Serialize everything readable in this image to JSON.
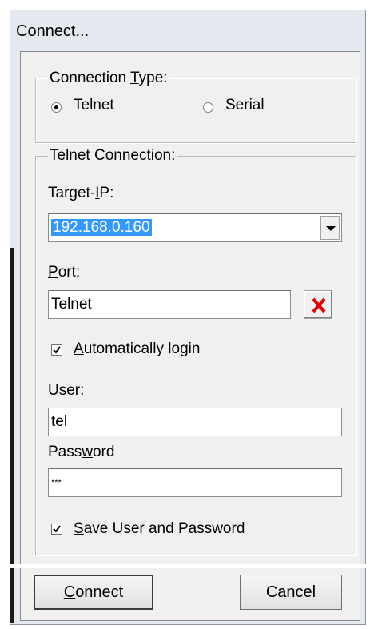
{
  "window": {
    "title": "Connect..."
  },
  "connection_type": {
    "legend_pre": "Connection ",
    "legend_u": "T",
    "legend_post": "ype:",
    "options": [
      {
        "label": "Telnet",
        "selected": true
      },
      {
        "label": "Serial",
        "selected": false
      }
    ]
  },
  "telnet": {
    "legend": "Telnet Connection:",
    "target_ip": {
      "label_pre": "Target-",
      "label_u": "I",
      "label_post": "P:",
      "value": "192.168.0.160"
    },
    "port": {
      "label_u": "P",
      "label_post": "ort:",
      "value": "Telnet"
    },
    "auto_login": {
      "label_u": "A",
      "label_post": "utomatically login",
      "checked": true
    },
    "user": {
      "label_u": "U",
      "label_post": "ser:",
      "value": "tel"
    },
    "password": {
      "label_pre": "Pass",
      "label_u": "w",
      "label_post": "ord",
      "value": "***"
    },
    "save": {
      "label_u": "S",
      "label_post": "ave User and Password",
      "checked": true
    }
  },
  "buttons": {
    "connect_u": "C",
    "connect_post": "onnect",
    "cancel": "Cancel"
  },
  "colors": {
    "selection": "#3399ff",
    "clear_icon": "#e00000"
  }
}
